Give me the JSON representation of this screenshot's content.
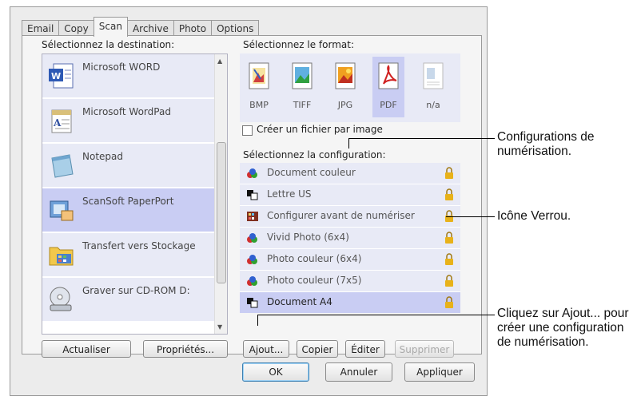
{
  "tabs": [
    "Email",
    "Copy",
    "Scan",
    "Archive",
    "Photo",
    "Options"
  ],
  "active_tab": "Scan",
  "labels": {
    "destination": "Sélectionnez la destination:",
    "format": "Sélectionnez le format:",
    "checkbox": "Créer un fichier par image",
    "configuration": "Sélectionnez la configuration:"
  },
  "destinations": [
    {
      "label": "Microsoft WORD",
      "icon": "word-icon",
      "selected": false
    },
    {
      "label": "Microsoft WordPad",
      "icon": "wordpad-icon",
      "selected": false
    },
    {
      "label": "Notepad",
      "icon": "notepad-icon",
      "selected": false
    },
    {
      "label": "ScanSoft PaperPort",
      "icon": "paperport-icon",
      "selected": true
    },
    {
      "label": "Transfert vers Stockage",
      "icon": "folder-icon",
      "selected": false
    },
    {
      "label": "Graver sur CD-ROM  D:",
      "icon": "cd-burn-icon",
      "selected": false
    }
  ],
  "formats": [
    {
      "label": "BMP",
      "selected": false
    },
    {
      "label": "TIFF",
      "selected": false
    },
    {
      "label": "JPG",
      "selected": false
    },
    {
      "label": "PDF",
      "selected": true
    },
    {
      "label": "n/a",
      "selected": false
    }
  ],
  "configurations": [
    {
      "label": "Document couleur",
      "selected": false
    },
    {
      "label": "Lettre US",
      "selected": false
    },
    {
      "label": "Configurer avant de numériser",
      "selected": false
    },
    {
      "label": "Vivid Photo (6x4)",
      "selected": false
    },
    {
      "label": "Photo couleur (6x4)",
      "selected": false
    },
    {
      "label": "Photo couleur (7x5)",
      "selected": false
    },
    {
      "label": "Document A4",
      "selected": true
    }
  ],
  "buttons": {
    "actualiser": "Actualiser",
    "proprietes": "Propriétés...",
    "ajout": "Ajout...",
    "copier": "Copier",
    "editer": "Éditer",
    "supprimer": "Supprimer",
    "ok": "OK",
    "annuler": "Annuler",
    "appliquer": "Appliquer"
  },
  "callouts": {
    "configurations": "Configurations de numérisation.",
    "lock_icon": "Icône Verrou.",
    "ajout": "Cliquez sur Ajout... pour créer une configuration de numérisation."
  },
  "colors": {
    "selected_row": "#c9cdf3",
    "row": "#e8eaf6",
    "lock": "#e8b21a"
  }
}
